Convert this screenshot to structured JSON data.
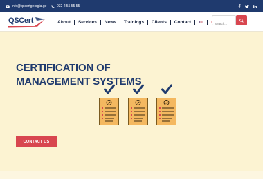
{
  "topbar": {
    "email": "info@qscertgeorgia.ge",
    "phone": "032 2 55 55 55",
    "social_icons": [
      "facebook-icon",
      "twitter-icon",
      "linkedin-icon"
    ]
  },
  "header": {
    "logo_text": "QSCert"
  },
  "nav": {
    "items": [
      {
        "label": "About"
      },
      {
        "label": "Services"
      },
      {
        "label": "News"
      },
      {
        "label": "Trainings"
      },
      {
        "label": "Clients"
      },
      {
        "label": "Contact"
      }
    ]
  },
  "search": {
    "placeholder": "Search..."
  },
  "hero": {
    "title_line1": "CERTIFICATION OF",
    "title_line2": "MANAGEMENT SYSTEMS",
    "cta_label": "CONTACT US"
  },
  "colors": {
    "primary": "#1f3a6e",
    "accent": "#d8464f",
    "background": "#fcf3d2",
    "doc": "#f4b860"
  }
}
